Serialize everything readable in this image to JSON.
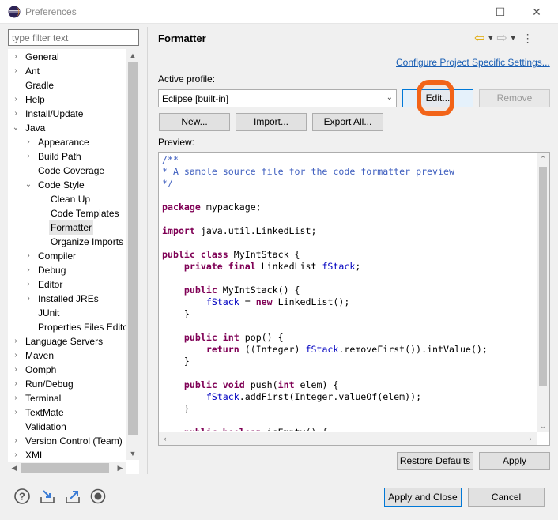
{
  "window": {
    "title": "Preferences",
    "minimize_glyph": "—",
    "maximize_glyph": "☐",
    "close_glyph": "✕"
  },
  "filter": {
    "placeholder": "type filter text",
    "value": ""
  },
  "tree": [
    {
      "label": "General",
      "arrow": "›"
    },
    {
      "label": "Ant",
      "arrow": "›"
    },
    {
      "label": "Gradle",
      "arrow": ""
    },
    {
      "label": "Help",
      "arrow": "›"
    },
    {
      "label": "Install/Update",
      "arrow": "›"
    },
    {
      "label": "Java",
      "arrow": "⌄"
    },
    {
      "label": "Appearance",
      "arrow": "›"
    },
    {
      "label": "Build Path",
      "arrow": "›"
    },
    {
      "label": "Code Coverage",
      "arrow": ""
    },
    {
      "label": "Code Style",
      "arrow": "⌄"
    },
    {
      "label": "Clean Up",
      "arrow": ""
    },
    {
      "label": "Code Templates",
      "arrow": ""
    },
    {
      "label": "Formatter",
      "arrow": ""
    },
    {
      "label": "Organize Imports",
      "arrow": ""
    },
    {
      "label": "Compiler",
      "arrow": "›"
    },
    {
      "label": "Debug",
      "arrow": "›"
    },
    {
      "label": "Editor",
      "arrow": "›"
    },
    {
      "label": "Installed JREs",
      "arrow": "›"
    },
    {
      "label": "JUnit",
      "arrow": ""
    },
    {
      "label": "Properties Files Edito",
      "arrow": ""
    },
    {
      "label": "Language Servers",
      "arrow": "›"
    },
    {
      "label": "Maven",
      "arrow": "›"
    },
    {
      "label": "Oomph",
      "arrow": "›"
    },
    {
      "label": "Run/Debug",
      "arrow": "›"
    },
    {
      "label": "Terminal",
      "arrow": "›"
    },
    {
      "label": "TextMate",
      "arrow": "›"
    },
    {
      "label": "Validation",
      "arrow": ""
    },
    {
      "label": "Version Control (Team)",
      "arrow": "›"
    },
    {
      "label": "XML",
      "arrow": "›"
    }
  ],
  "page": {
    "title": "Formatter",
    "configure_link": "Configure Project Specific Settings...",
    "active_profile_label": "Active profile:",
    "profile_value": "Eclipse [built-in]",
    "edit_button": "Edit...",
    "remove_button": "Remove",
    "new_button": "New...",
    "import_button": "Import...",
    "export_button": "Export All...",
    "preview_label": "Preview:",
    "restore_defaults_button": "Restore Defaults",
    "apply_button": "Apply"
  },
  "preview_code": [
    "/**",
    "* A sample source file for the code formatter preview",
    "*/",
    "",
    "package mypackage;",
    "",
    "import java.util.LinkedList;",
    "",
    "public class MyIntStack {",
    "    private final LinkedList fStack;",
    "",
    "    public MyIntStack() {",
    "        fStack = new LinkedList();",
    "    }",
    "",
    "    public int pop() {",
    "        return ((Integer) fStack.removeFirst()).intValue();",
    "    }",
    "",
    "    public void push(int elem) {",
    "        fStack.addFirst(Integer.valueOf(elem));",
    "    }",
    "",
    "    public boolean isEmpty() {"
  ],
  "footer": {
    "apply_close_button": "Apply and Close",
    "cancel_button": "Cancel"
  },
  "icons": {
    "help": "help-icon",
    "import": "import-prefs-icon",
    "export": "export-prefs-icon",
    "record": "record-icon"
  },
  "colors": {
    "accent": "#0078d7",
    "link": "#1a5fb4",
    "highlight_marker": "#f26419",
    "keyword": "#7f0055",
    "comment": "#3f5fbf",
    "field": "#0000c0"
  }
}
